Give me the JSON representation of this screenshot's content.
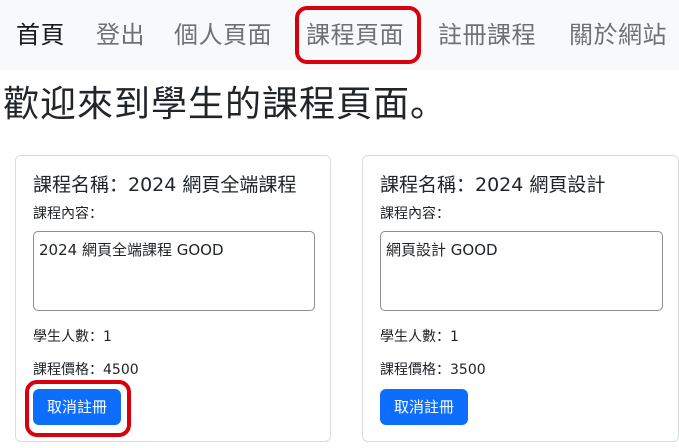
{
  "nav": {
    "items": [
      {
        "label": "首頁"
      },
      {
        "label": "登出"
      },
      {
        "label": "個人頁面"
      },
      {
        "label": "課程頁面"
      },
      {
        "label": "註冊課程"
      },
      {
        "label": "關於網站"
      }
    ],
    "highlighted_item": "課程頁面",
    "background_color": "#f8f9fa"
  },
  "main": {
    "heading": "歡迎來到學生的課程頁面。"
  },
  "courses": [
    {
      "title": "課程名稱：2024 網頁全端課程",
      "content_label": "課程內容：",
      "content": "2024 網頁全端課程 GOOD",
      "students": "學生人數：1",
      "price": "課程價格：4500",
      "button_label": "取消註冊"
    },
    {
      "title": "課程名稱：2024 網頁設計",
      "content_label": "課程內容：",
      "content": "網頁設計 GOOD",
      "students": "學生人數：1",
      "price": "課程價格：3500",
      "button_label": "取消註冊"
    }
  ],
  "colors": {
    "primary_button": "#0d6efd",
    "highlight_outline": "#d9000d"
  }
}
